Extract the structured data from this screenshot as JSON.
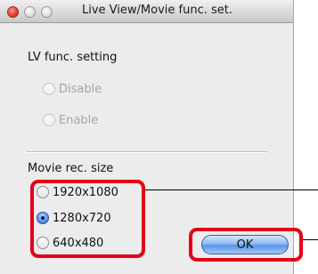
{
  "window": {
    "title": "Live View/Movie func. set."
  },
  "lv_func": {
    "label": "LV func. setting",
    "options": [
      {
        "label": "Disable",
        "state": "disabled"
      },
      {
        "label": "Enable",
        "state": "disabled"
      }
    ]
  },
  "movie_rec": {
    "label": "Movie rec. size",
    "options": [
      {
        "label": "1920x1080",
        "selected": false
      },
      {
        "label": "1280x720",
        "selected": true
      },
      {
        "label": "640x480",
        "selected": false
      }
    ]
  },
  "buttons": {
    "ok_label": "OK"
  },
  "colors": {
    "highlight": "#e3001b",
    "window_bg": "#ececec",
    "button_accent": "#5b95e3"
  },
  "icons": {
    "close": "close-icon",
    "minimize": "minimize-icon",
    "maximize": "zoom-icon"
  }
}
